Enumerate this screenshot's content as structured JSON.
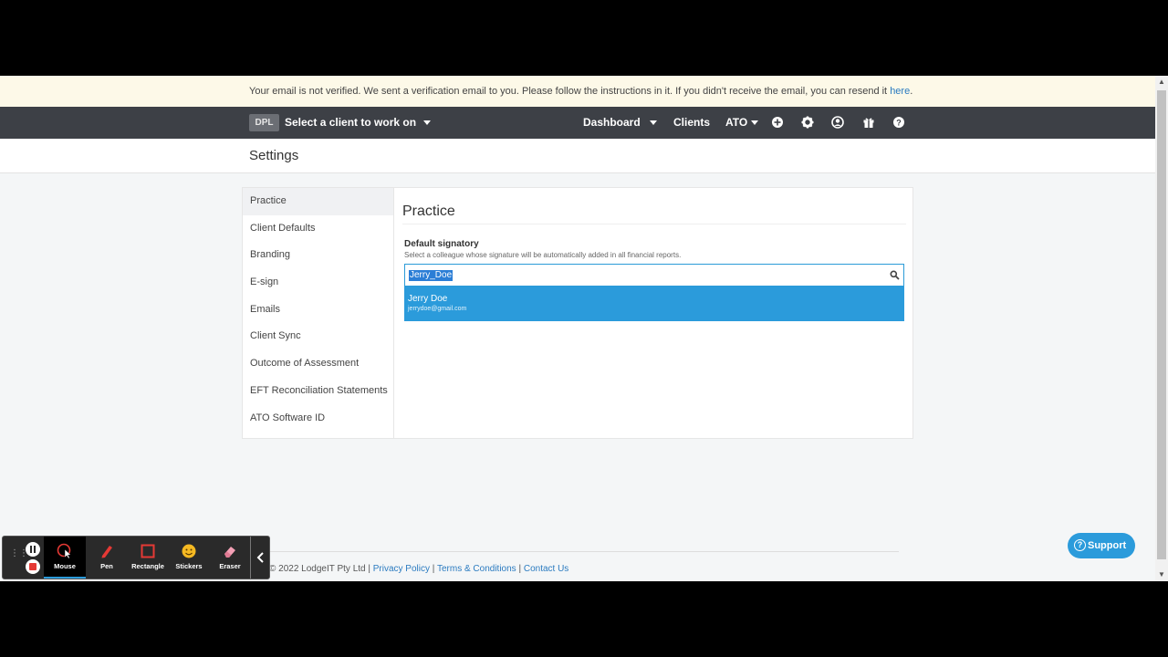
{
  "banner": {
    "text": "Your email is not verified. We sent a verification email to you. Please follow the instructions in it. If you didn't receive the email, you can resend it ",
    "link": "here",
    "end": "."
  },
  "navbar": {
    "badge": "DPL",
    "client_select": "Select a client to work on",
    "dashboard": "Dashboard",
    "clients": "Clients",
    "ato": "ATO",
    "icons": [
      "plus-circle-icon",
      "gear-icon",
      "user-circle-icon",
      "gift-icon",
      "help-circle-icon"
    ]
  },
  "page": {
    "title": "Settings"
  },
  "sidebar": {
    "items": [
      {
        "label": "Practice"
      },
      {
        "label": "Client Defaults"
      },
      {
        "label": "Branding"
      },
      {
        "label": "E-sign"
      },
      {
        "label": "Emails"
      },
      {
        "label": "Client Sync"
      },
      {
        "label": "Outcome of Assessment"
      },
      {
        "label": "EFT Reconciliation Statements"
      },
      {
        "label": "ATO Software ID"
      }
    ],
    "active_index": 0
  },
  "practice": {
    "heading": "Practice",
    "signatory_label": "Default signatory",
    "signatory_help": "Select a colleague whose signature will be automatically added in all financial reports.",
    "search_value": "Jerry_Doe",
    "suggestion": {
      "name": "Jerry Doe",
      "email": "jerrydoe@gmail.com"
    }
  },
  "footer": {
    "copyright": "© 2022 LodgeIT Pty Ltd | ",
    "privacy": "Privacy Policy",
    "sep1": " | ",
    "terms": "Terms & Conditions",
    "sep2": " | ",
    "contact": "Contact Us"
  },
  "support": {
    "label": "Support",
    "icon": "?"
  },
  "toolbar": {
    "tools": [
      {
        "label": "Mouse",
        "icon": "mouse-pointer-icon"
      },
      {
        "label": "Pen",
        "icon": "pen-icon"
      },
      {
        "label": "Rectangle",
        "icon": "rectangle-icon"
      },
      {
        "label": "Stickers",
        "icon": "sticker-icon"
      },
      {
        "label": "Eraser",
        "icon": "eraser-icon"
      }
    ],
    "active_tool": "Mouse"
  },
  "colors": {
    "accent": "#2b9bdb",
    "navbar": "#3d4046",
    "banner": "#fdf9e8"
  }
}
